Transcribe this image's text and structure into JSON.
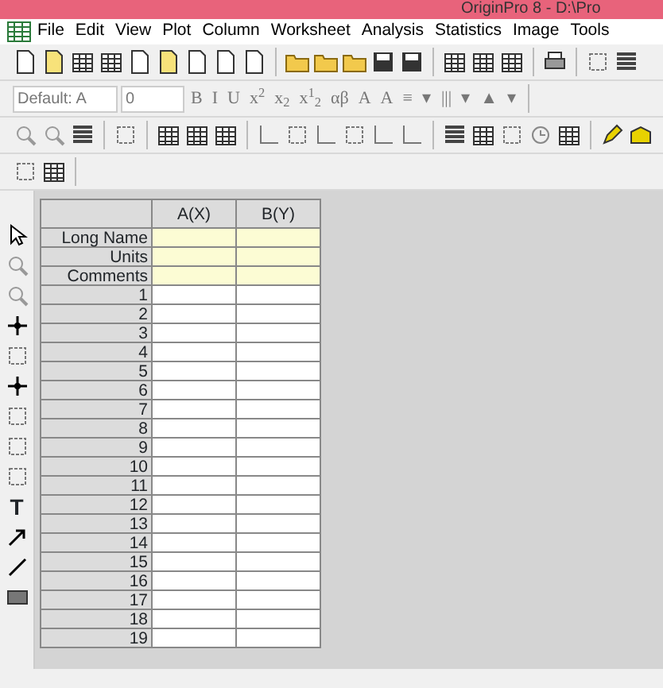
{
  "window": {
    "title": "OriginPro 8 - D:\\Pro"
  },
  "menu": [
    "File",
    "Edit",
    "View",
    "Plot",
    "Column",
    "Worksheet",
    "Analysis",
    "Statistics",
    "Image",
    "Tools"
  ],
  "format_toolbar": {
    "font": "Default: A",
    "size": "0",
    "buttons": [
      "B",
      "I",
      "U",
      "x$^{2}$",
      "x$_{2}$",
      "x$^{1}$$_{2}$",
      "αβ",
      "A",
      "A",
      "≡",
      "▾",
      "|||",
      "▾",
      "▲",
      "▾"
    ]
  },
  "left_toolbar": {
    "text_tool": "T"
  },
  "sheet": {
    "columns": [
      "A(X)",
      "B(Y)"
    ],
    "label_rows": [
      "Long Name",
      "Units",
      "Comments"
    ],
    "rows": [
      "1",
      "2",
      "3",
      "4",
      "5",
      "6",
      "7",
      "8",
      "9",
      "10",
      "11",
      "12",
      "13",
      "14",
      "15",
      "16",
      "17",
      "18",
      "19"
    ]
  }
}
